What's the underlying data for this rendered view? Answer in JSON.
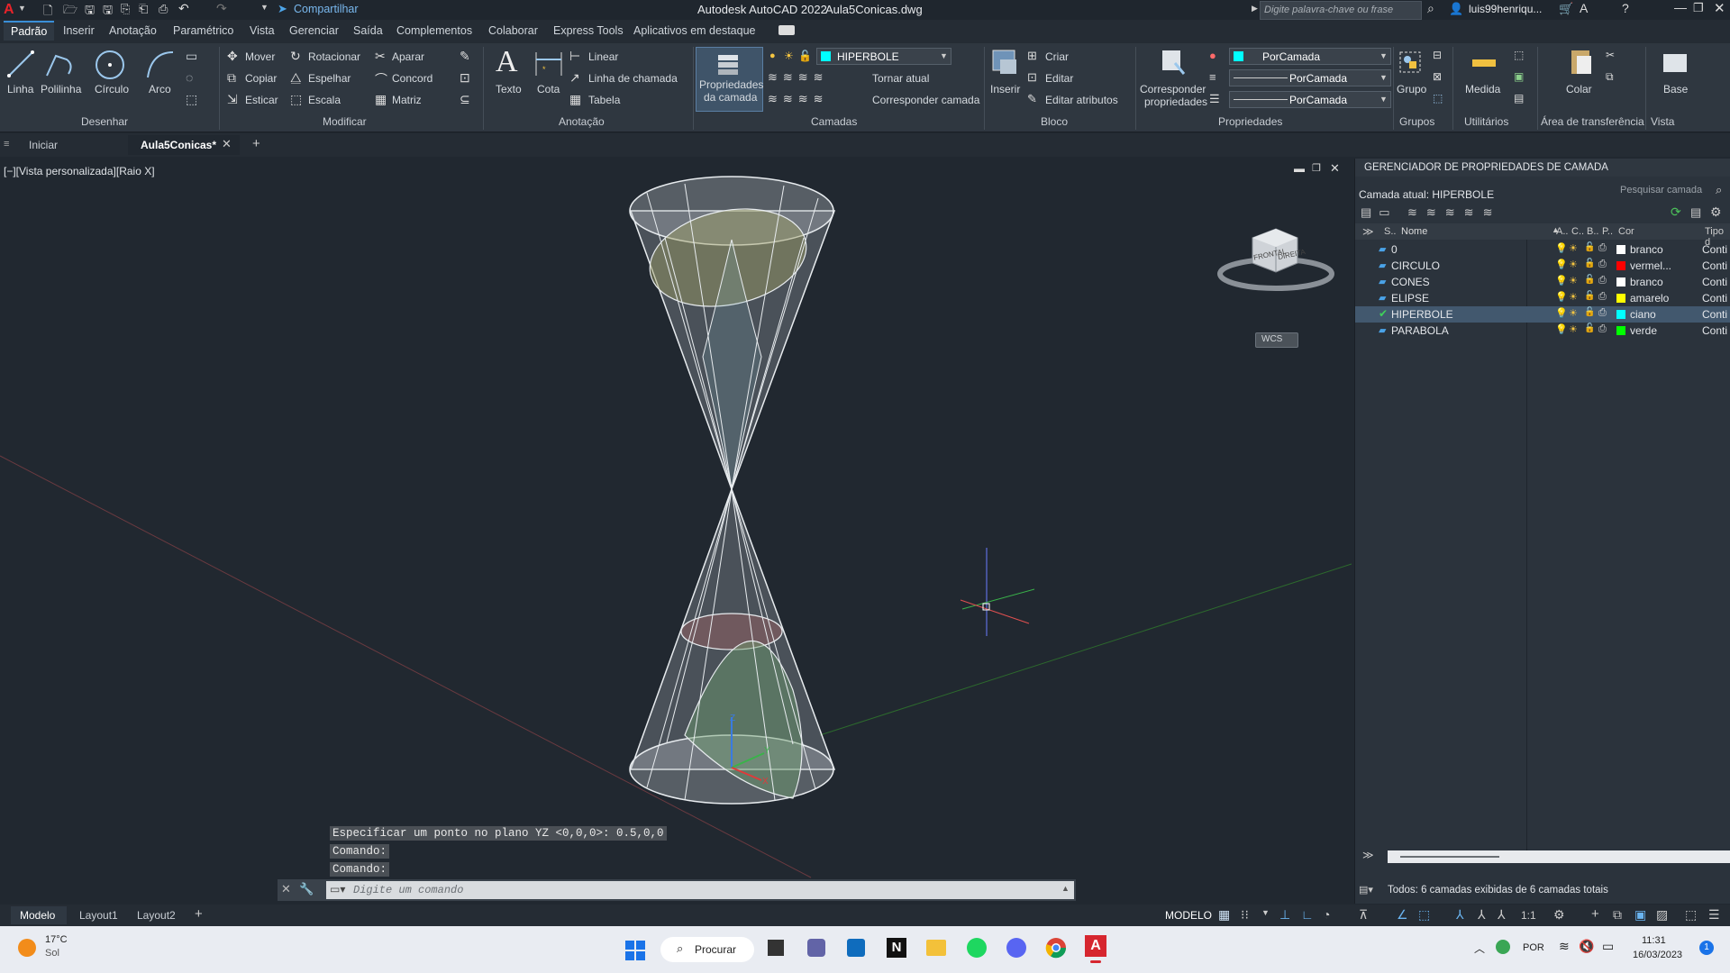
{
  "titlebar": {
    "app_title": "Autodesk AutoCAD 2022",
    "file_name": "Aula5Conicas.dwg",
    "share_label": "Compartilhar",
    "search_placeholder": "Digite palavra-chave ou frase",
    "user": "luis99henriqu..."
  },
  "ribbon_tabs": [
    "Padrão",
    "Inserir",
    "Anotação",
    "Paramétrico",
    "Vista",
    "Gerenciar",
    "Saída",
    "Complementos",
    "Colaborar",
    "Express Tools",
    "Aplicativos em destaque"
  ],
  "ribbon": {
    "draw": {
      "linha": "Linha",
      "polilinha": "Polilinha",
      "circulo": "Círculo",
      "arco": "Arco",
      "panel": "Desenhar"
    },
    "modify": {
      "mover": "Mover",
      "rotacionar": "Rotacionar",
      "aparar": "Aparar",
      "copiar": "Copiar",
      "espelhar": "Espelhar",
      "concord": "Concord",
      "esticar": "Esticar",
      "escala": "Escala",
      "matriz": "Matriz",
      "panel": "Modificar"
    },
    "annotation": {
      "texto": "Texto",
      "cota": "Cota",
      "linear": "Linear",
      "linha_chamada": "Linha de chamada",
      "tabela": "Tabela",
      "panel": "Anotação"
    },
    "layers": {
      "props_line1": "Propriedades",
      "props_line2": "da camada",
      "current_layer": "HIPERBOLE",
      "tornar_atual": "Tornar atual",
      "corresponder": "Corresponder camada",
      "panel": "Camadas"
    },
    "block": {
      "inserir": "Inserir",
      "criar": "Criar",
      "editar": "Editar",
      "editar_atributos": "Editar atributos",
      "panel": "Bloco"
    },
    "properties": {
      "match_line1": "Corresponder",
      "match_line2": "propriedades",
      "color": "PorCamada",
      "linetype": "PorCamada",
      "lineweight": "PorCamada",
      "panel": "Propriedades"
    },
    "groups": {
      "grupo": "Grupo",
      "panel": "Grupos"
    },
    "utilities": {
      "medida": "Medida",
      "panel": "Utilitários"
    },
    "clipboard": {
      "colar": "Colar",
      "panel": "Área de transferência"
    },
    "view": {
      "base": "Base",
      "panel": "Vista"
    }
  },
  "doc_tabs": {
    "start": "Iniciar",
    "active": "Aula5Conicas*"
  },
  "viewport": {
    "label": "[−][Vista personalizada][Raio X]",
    "viewcube_front": "FRONTAL",
    "viewcube_right": "DIREITA",
    "wcs": "WCS",
    "ucs_z": "Z",
    "ucs_y": "Y",
    "ucs_x": "X"
  },
  "command": {
    "history": [
      "Especificar um ponto no plano YZ <0,0,0>: 0.5,0,0",
      "Comando:",
      "Comando:"
    ],
    "placeholder": "Digite um comando"
  },
  "layer_panel": {
    "title": "GERENCIADOR DE PROPRIEDADES DE CAMADA",
    "search_placeholder": "Pesquisar camada",
    "current": "Camada atual: HIPERBOLE",
    "headers": {
      "s": "S..",
      "nome": "Nome",
      "a": "A..",
      "c": "C..",
      "b": "B..",
      "p": "P..",
      "cor": "Cor",
      "tipo": "Tipo d"
    },
    "layers": [
      {
        "name": "0",
        "color_name": "branco",
        "color": "#ffffff",
        "type": "Conti"
      },
      {
        "name": "CIRCULO",
        "color_name": "vermel...",
        "color": "#ff0000",
        "type": "Conti"
      },
      {
        "name": "CONES",
        "color_name": "branco",
        "color": "#ffffff",
        "type": "Conti"
      },
      {
        "name": "ELIPSE",
        "color_name": "amarelo",
        "color": "#ffff00",
        "type": "Conti"
      },
      {
        "name": "HIPERBOLE",
        "color_name": "ciano",
        "color": "#00ffff",
        "type": "Conti"
      },
      {
        "name": "PARABOLA",
        "color_name": "verde",
        "color": "#00ff00",
        "type": "Conti"
      }
    ],
    "footer": "Todos: 6 camadas exibidas de 6 camadas totais"
  },
  "layout_tabs": [
    "Modelo",
    "Layout1",
    "Layout2"
  ],
  "status": {
    "mode": "MODELO",
    "scale": "1:1"
  },
  "taskbar": {
    "temp": "17°C",
    "weather": "Sol",
    "search": "Procurar",
    "lang": "POR",
    "time": "11:31",
    "date": "16/03/2023",
    "notif": "1"
  }
}
